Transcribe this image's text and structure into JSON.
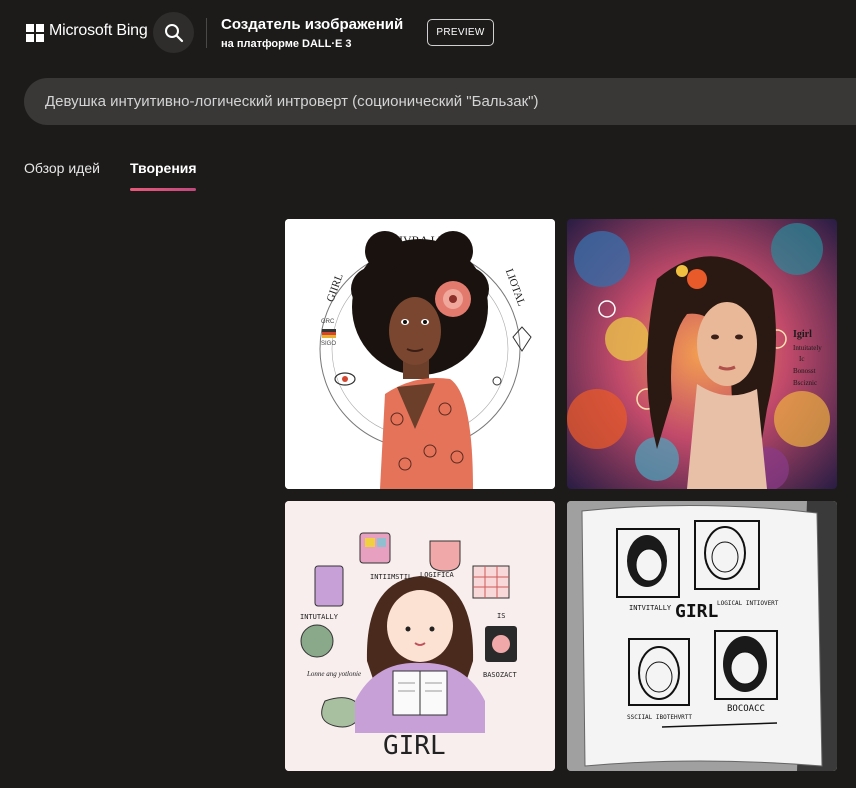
{
  "header": {
    "brand": "Microsoft Bing",
    "search_icon": "search-icon",
    "title": "Создатель изображений",
    "subtitle": "на платформе DALL·E 3",
    "badge": "PREVIEW"
  },
  "prompt": {
    "value": "Девушка интуитивно-логический интроверт (соционический \"Бальзак\")"
  },
  "tabs": [
    {
      "label": "Обзор идей",
      "active": false
    },
    {
      "label": "Творения",
      "active": true
    }
  ],
  "colors": {
    "background": "#1c1b1a",
    "prompt_bar": "#393837",
    "tab_accent": "#e85a7a"
  },
  "images": [
    {
      "name": "afro-girl-sketch",
      "texts": {
        "arc": "INTIIVRA LLY",
        "left": "GIIRL",
        "right": "LIOTAL",
        "small1": "GRC",
        "small2": "SIGO"
      }
    },
    {
      "name": "colorful-girl-painting",
      "texts": {
        "l1": "Igirl",
        "l2": "Intuitately",
        "l3": "Ic",
        "l4": "Bonosst",
        "l5": "Bsciznic"
      }
    },
    {
      "name": "cartoon-girl-reading",
      "texts": {
        "a": "INTIIMSTIL",
        "b": "LOGIFICA",
        "c": "INTUTALLY",
        "d": "BASOZACT",
        "e": "GIRL",
        "f": "Lonne ang yotlonie",
        "g": "IS"
      }
    },
    {
      "name": "notebook-comic",
      "texts": {
        "a": "INTVITALLY",
        "b": "GIRL",
        "c": "LOGICAL INTIOVERT",
        "d": "SSCIIAL IBOTEHVRTT",
        "e": "BOCOACC"
      }
    }
  ]
}
